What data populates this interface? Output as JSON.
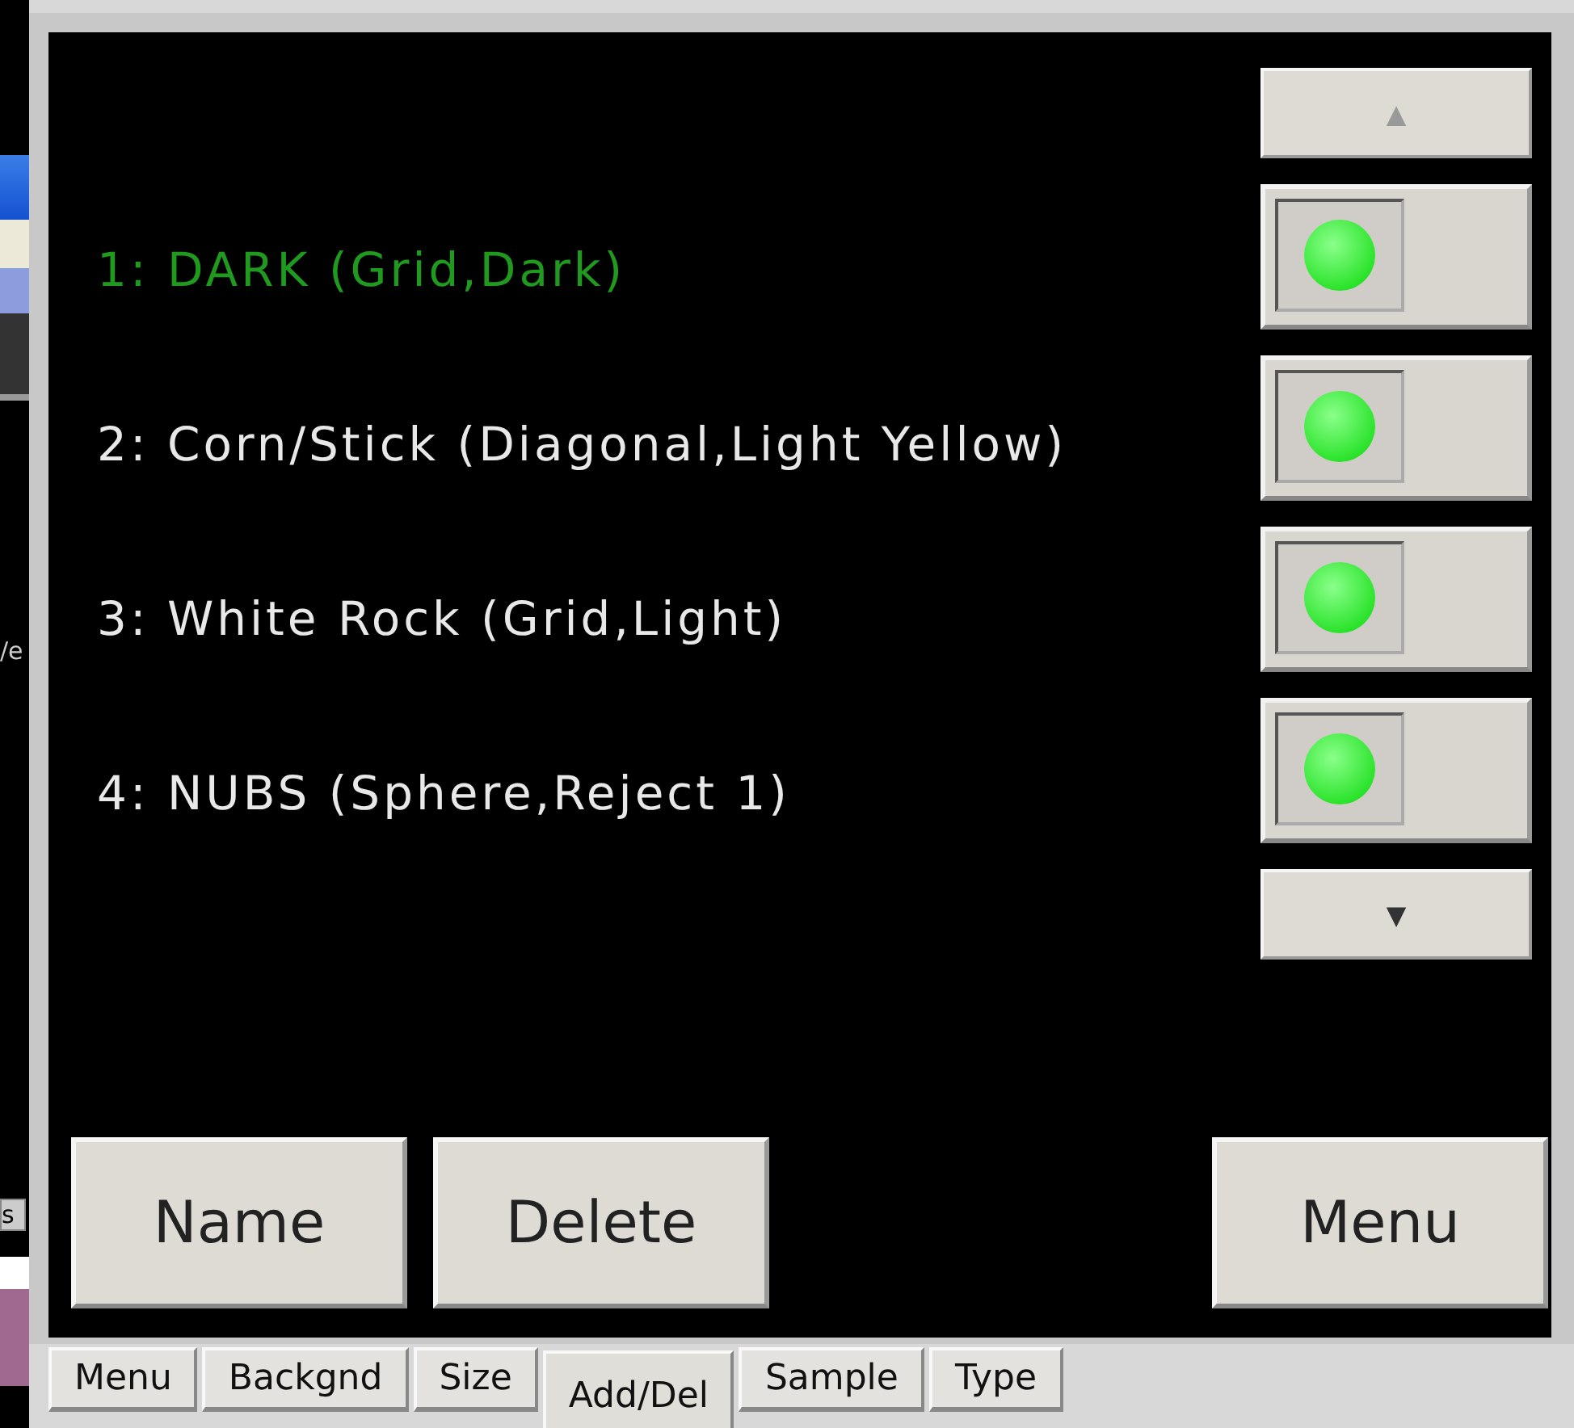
{
  "background_window": {
    "texts": [
      "/e",
      "s"
    ]
  },
  "scroll_up": {
    "label": "▲"
  },
  "items": [
    {
      "label": "1: DARK (Grid,Dark)",
      "selected": true,
      "on": true
    },
    {
      "label": "2: Corn/Stick (Diagonal,Light Yellow)",
      "selected": false,
      "on": true
    },
    {
      "label": "3: White Rock (Grid,Light)",
      "selected": false,
      "on": true
    },
    {
      "label": "4: NUBS (Sphere,Reject 1)",
      "selected": false,
      "on": true
    }
  ],
  "scroll_down": {
    "label": "▼"
  },
  "buttons": [
    "Name",
    "Delete",
    "Menu"
  ],
  "tabs": [
    {
      "label": "Menu",
      "selected": false
    },
    {
      "label": "Backgnd",
      "selected": false
    },
    {
      "label": "Size",
      "selected": false
    },
    {
      "label": "Add/Del",
      "selected": true
    },
    {
      "label": "Sample",
      "selected": false
    },
    {
      "label": "Type",
      "selected": false
    }
  ]
}
